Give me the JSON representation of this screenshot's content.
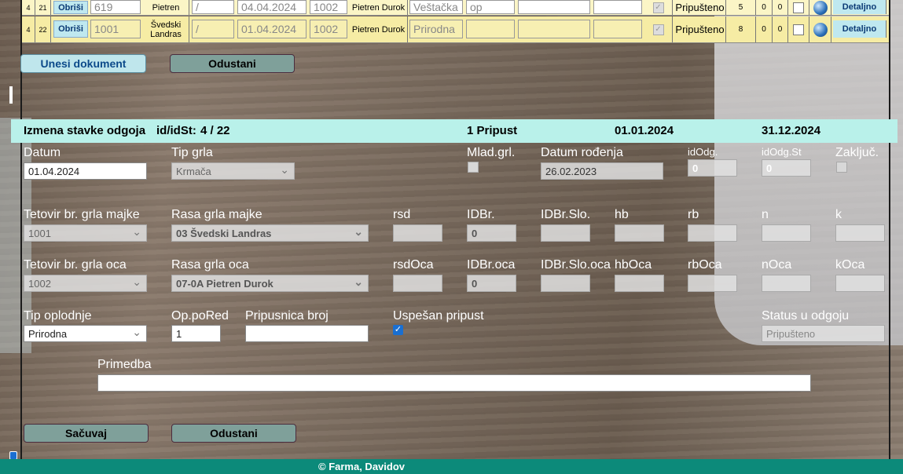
{
  "table": {
    "rows": [
      {
        "c1": "4",
        "c2": "21",
        "delete": "Obriši",
        "tet": "619",
        "rasa": "Pietren",
        "slash": "/",
        "datum": "04.04.2024",
        "otac": "1002",
        "rasa_oca": "Pietren Durok",
        "tip": "Veštačka",
        "note": "op",
        "status": "Pripušteno",
        "n1": "5",
        "n2": "0",
        "n3": "0",
        "details": "Detaljno"
      },
      {
        "c1": "4",
        "c2": "22",
        "delete": "Obriši",
        "tet": "1001",
        "rasa": "Švedski Landras",
        "slash": "/",
        "datum": "01.04.2024",
        "otac": "1002",
        "rasa_oca": "Pietren Durok",
        "tip": "Prirodna",
        "note": "",
        "status": "Pripušteno",
        "n1": "8",
        "n2": "0",
        "n3": "0",
        "details": "Detaljno"
      }
    ]
  },
  "buttons": {
    "enter_doc": "Unesi dokument",
    "cancel_top": "Odustani",
    "save": "Sačuvaj",
    "cancel_bottom": "Odustani"
  },
  "header": {
    "title": "Izmena stavke  odgoja",
    "id_label": "id/idSt:",
    "id_value": "4 / 22",
    "pripust": "1 Pripust",
    "date_from": "01.01.2024",
    "date_to": "31.12.2024"
  },
  "form": {
    "datum_label": "Datum",
    "datum_value": "01.04.2024",
    "tip_grla_label": "Tip grla",
    "tip_grla_value": "Krmača",
    "mlad_label": "Mlad.grl.",
    "datum_rodj_label": "Datum rođenja",
    "datum_rodj_value": "26.02.2023",
    "idodg_label": "idOdg.",
    "idodg_value": "0",
    "idodgst_label": "idOdg.St",
    "idodgst_value": "0",
    "zakljuc_label": "Zaključ.",
    "tet_majke_label": "Tetovir br. grla majke",
    "tet_majke_value": "1001",
    "rasa_majke_label": "Rasa grla majke",
    "rasa_majke_value": "03 Švedski Landras",
    "rsd_label": "rsd",
    "idbr_label": "IDBr.",
    "idbr_value": "0",
    "idbrslo_label": "IDBr.Slo.",
    "hb_label": "hb",
    "rb_label": "rb",
    "n_label": "n",
    "k_label": "k",
    "tet_oca_label": "Tetovir br. grla oca",
    "tet_oca_value": "1002",
    "rasa_oca_label": "Rasa grla oca",
    "rasa_oca_value": "07-0A Pietren Durok",
    "rsdoca_label": "rsdOca",
    "idbroca_label": "IDBr.oca",
    "idbroca_value": "0",
    "idbrslooca_label": "IDBr.Slo.oca",
    "hboca_label": "hbOca",
    "rboca_label": "rbOca",
    "noca_label": "nOca",
    "koca_label": "kOca",
    "tip_oplodnje_label": "Tip oplodnje",
    "tip_oplodnje_value": "Prirodna",
    "oporedj_label": "Op.poRed",
    "oporedj_value": "1",
    "pripusnica_label": "Pripusnica broj",
    "pripusnica_value": "",
    "uspesan_label": "Uspešan pripust",
    "status_label": "Status u odgoju",
    "status_value": "Pripušteno",
    "primedba_label": "Primedba",
    "primedba_value": ""
  },
  "footer": {
    "text": "© Farma, Davidov"
  }
}
